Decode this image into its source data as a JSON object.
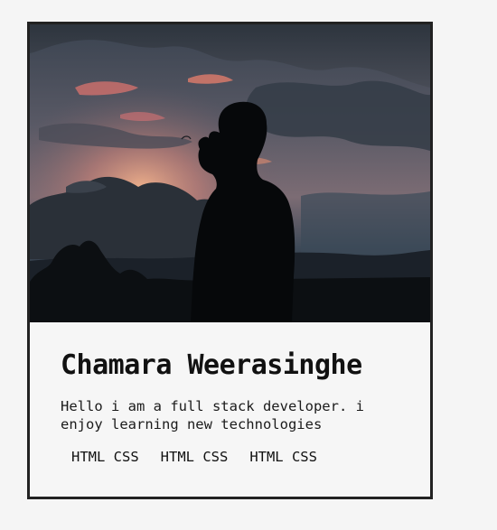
{
  "card": {
    "image_alt": "silhouette of a person at sunset",
    "name": "Chamara Weerasinghe",
    "description": "Hello i am a full stack developer. i enjoy learning new technologies",
    "tags": [
      "HTML CSS",
      "HTML CSS",
      "HTML CSS"
    ]
  },
  "colors": {
    "page_background": "#f5f5f5",
    "card_border": "#222222",
    "card_background": "#f6f6f6",
    "text": "#111111"
  }
}
